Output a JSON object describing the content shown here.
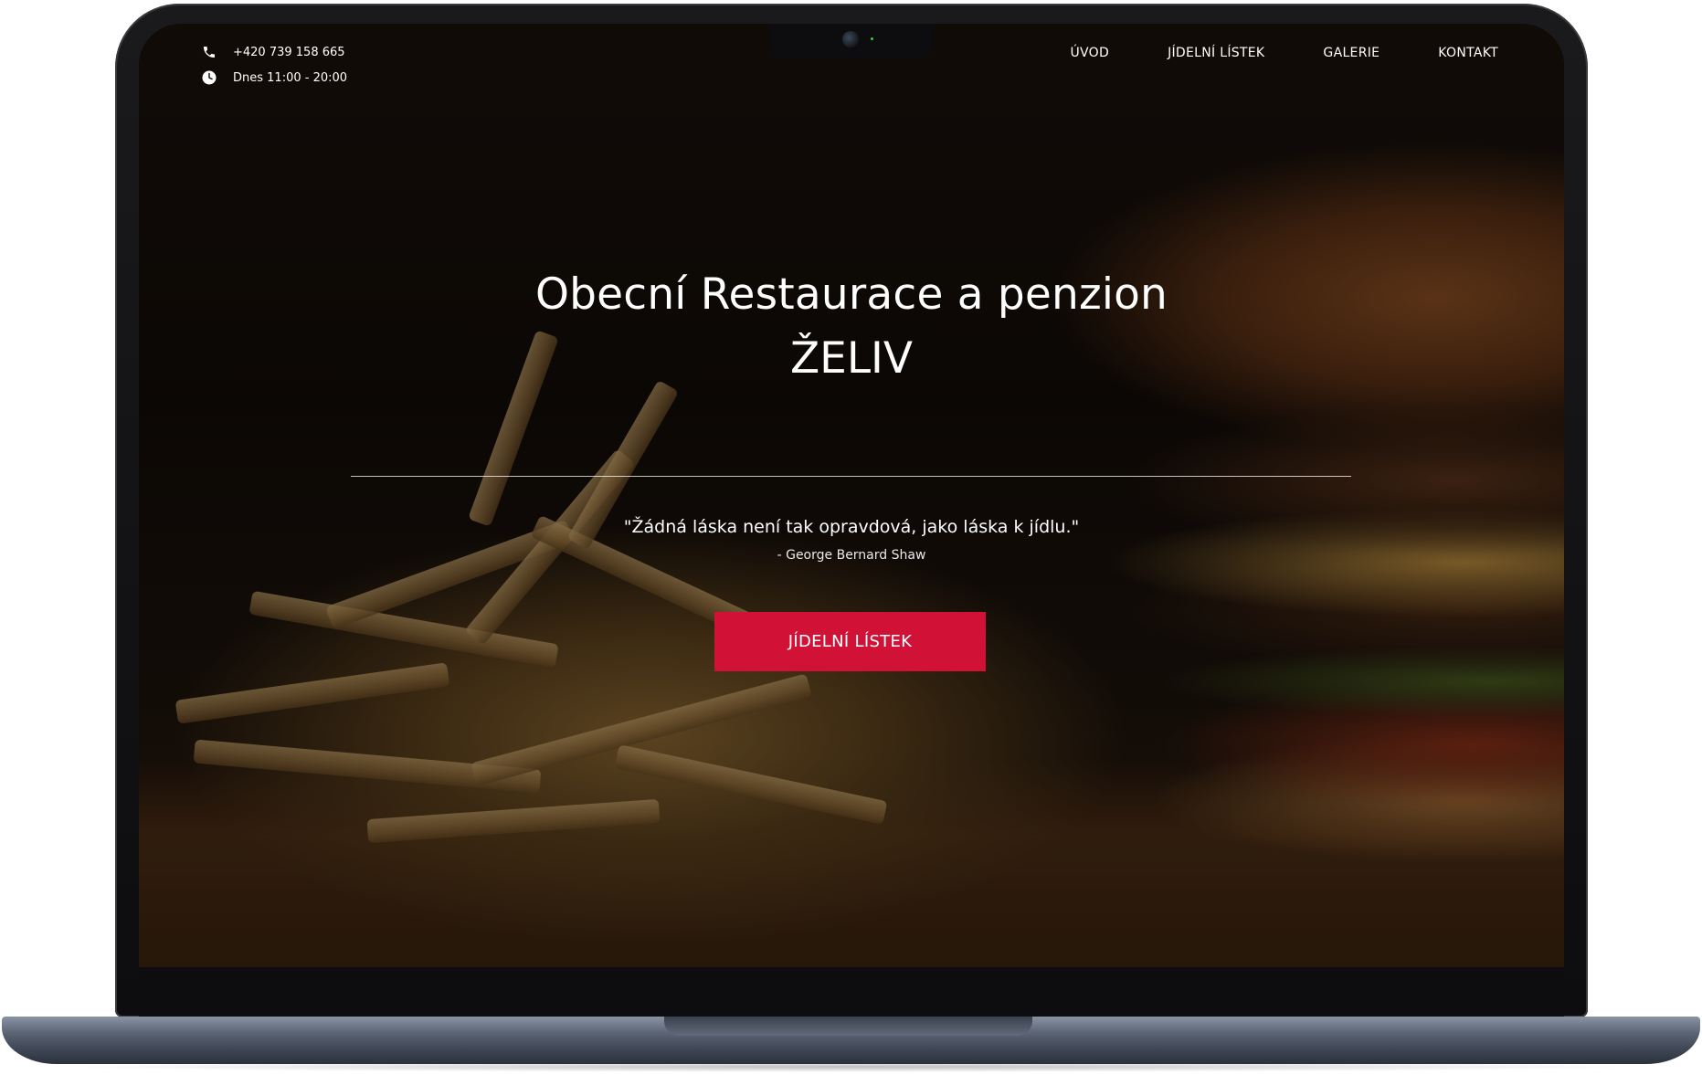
{
  "topbar": {
    "phone": "+420 739 158 665",
    "hours": "Dnes 11:00 - 20:00"
  },
  "nav": {
    "items": [
      {
        "label": "ÚVOD"
      },
      {
        "label": "JÍDELNÍ LÍSTEK"
      },
      {
        "label": "GALERIE"
      },
      {
        "label": "KONTAKT"
      }
    ]
  },
  "hero": {
    "title_line1": "Obecní Restaurace a penzion",
    "title_line2": "ŽELIV",
    "quote": "\"Žádná láska není tak opravdová, jako láska k jídlu.\"",
    "author": "- George Bernard Shaw",
    "cta_label": "JÍDELNÍ LÍSTEK"
  },
  "icons": {
    "phone": "phone-icon",
    "clock": "clock-icon"
  },
  "colors": {
    "accent": "#d11236",
    "text": "#ffffff",
    "device": "#0d0d0f"
  }
}
